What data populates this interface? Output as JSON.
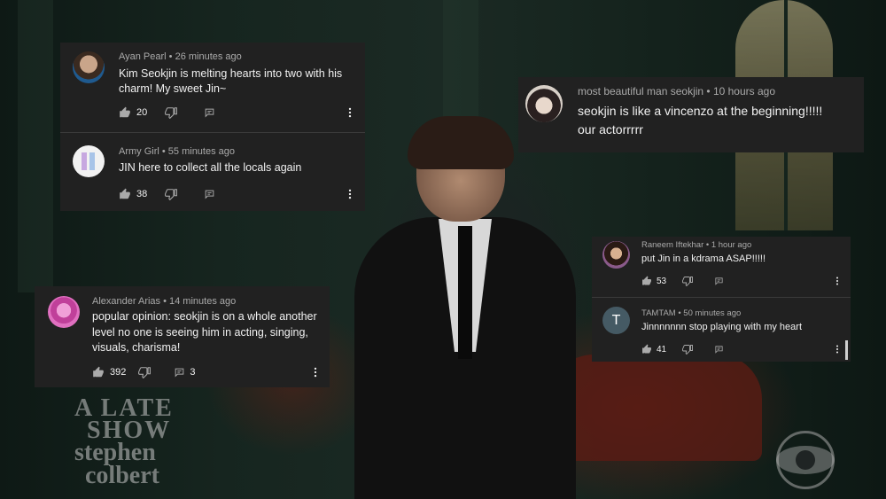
{
  "background": {
    "show_logo": {
      "line1": "A LATE",
      "line2": "SHOW",
      "line3": "stephen",
      "line4": "colbert"
    }
  },
  "cards": {
    "card1": {
      "c1": {
        "author": "Ayan Pearl • 26 minutes ago",
        "text": "Kim Seokjin is melting hearts into two with his charm! My sweet Jin~",
        "likes": "20"
      },
      "c2": {
        "author": "Army Girl • 55 minutes ago",
        "text": "JIN here to collect all the locals again",
        "likes": "38"
      }
    },
    "card2": {
      "c1": {
        "author": "Alexander Arias • 14 minutes ago",
        "text": "popular opinion: seokjin is on a whole another level no one is seeing him in acting, singing, visuals, charisma!",
        "likes": "392",
        "replies": "3"
      }
    },
    "card3": {
      "c1": {
        "author": "most beautiful man seokjin • 10 hours ago",
        "text": "seokjin is like a vincenzo at the beginning!!!!! our actorrrrr"
      }
    },
    "card4": {
      "c1": {
        "author": "Raneem Iftekhar • 1 hour ago",
        "text": "put Jin in a kdrama ASAP!!!!!",
        "likes": "53"
      },
      "c2": {
        "author": "TAMTAM • 50 minutes ago",
        "avatar_letter": "T",
        "text": "Jinnnnnnn stop playing with my heart",
        "likes": "41"
      }
    }
  },
  "icons": [
    "like-icon",
    "dislike-icon",
    "reply-icon",
    "more-vert-icon"
  ],
  "colors": {
    "card_bg": "#212121",
    "meta": "#aaaaaa",
    "text": "#f1f1f1",
    "avatar_t": "#455a64"
  }
}
